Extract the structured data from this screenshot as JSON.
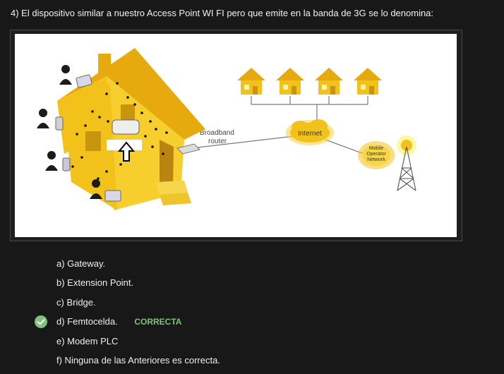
{
  "question": {
    "text": "4) El dispositivo similar a nuestro Access Point WI FI pero que emite en la banda de 3G se lo denomina:"
  },
  "figure": {
    "labels": {
      "router": [
        "Broadband",
        "router"
      ],
      "internet": "Internet",
      "mobile": [
        "Mobile",
        "Operator",
        "Network"
      ]
    },
    "colors": {
      "house": "#f2c21a",
      "house_dark": "#c9950f",
      "roof": "#e6a90e",
      "accent_glow": "#fff59c"
    }
  },
  "options": [
    {
      "label": "a) Gateway.",
      "selected": false
    },
    {
      "label": "b) Extension Point.",
      "selected": false
    },
    {
      "label": "c) Bridge.",
      "selected": false
    },
    {
      "label": "d) Femtocelda.",
      "selected": true,
      "status": "CORRECTA"
    },
    {
      "label": "e) Modem PLC",
      "selected": false
    },
    {
      "label": "f) Ninguna de las Anteriores es correcta.",
      "selected": false
    }
  ],
  "status_colors": {
    "correct": "#7ec27e"
  }
}
